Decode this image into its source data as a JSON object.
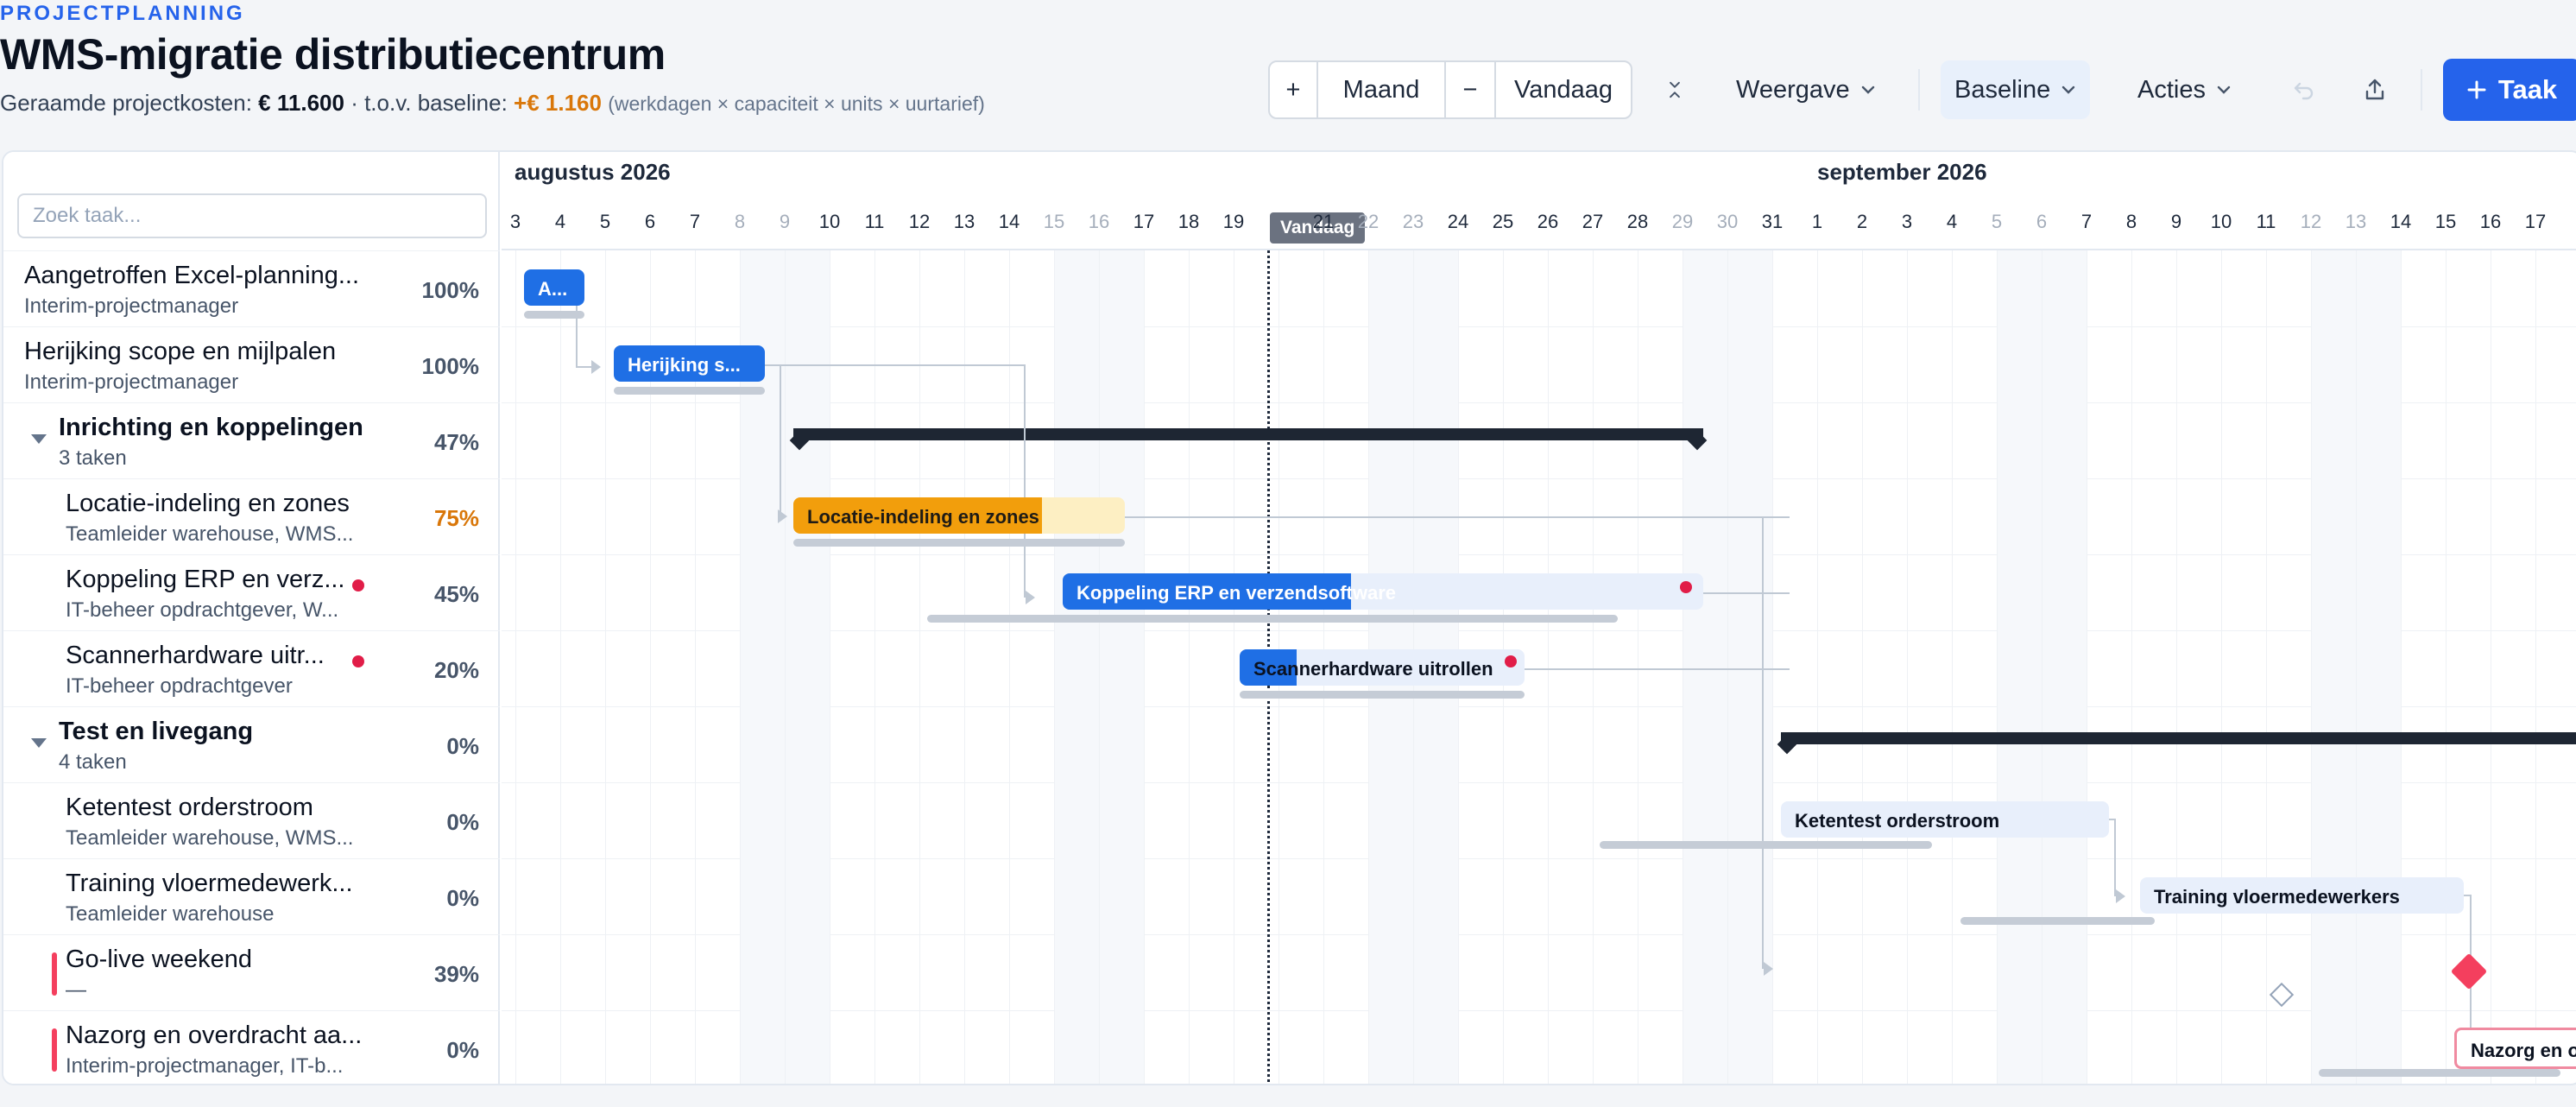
{
  "header": {
    "eyebrow": "PROJECTPLANNING",
    "title": "WMS-migratie distributiecentrum",
    "cost_label": "Geraamde projectkosten:",
    "cost_value": "€ 11.600",
    "baseline_label": "· t.o.v. baseline:",
    "baseline_delta": "+€ 1.160",
    "formula_note": "(werkdagen × capaciteit × units × uurtarief)"
  },
  "toolbar": {
    "zoom_in": "+",
    "scale": "Maand",
    "zoom_out": "−",
    "today": "Vandaag",
    "collapse_icon": "collapse-icon",
    "view": "Weergave",
    "baseline": "Baseline",
    "actions": "Acties",
    "undo_icon": "undo-icon",
    "export_icon": "export-icon",
    "add_task": "Taak",
    "accent": "#2563eb"
  },
  "search": {
    "placeholder": "Zoek taak..."
  },
  "timeline": {
    "months": [
      "augustus 2026",
      "september 2026"
    ],
    "days": [
      "3",
      "4",
      "5",
      "6",
      "7",
      "8",
      "9",
      "10",
      "11",
      "12",
      "13",
      "14",
      "15",
      "16",
      "17",
      "18",
      "19",
      "20",
      "21",
      "22",
      "23",
      "24",
      "25",
      "26",
      "27",
      "28",
      "29",
      "30",
      "31",
      "1",
      "2",
      "3",
      "4",
      "5",
      "6",
      "7",
      "8",
      "9",
      "10",
      "11",
      "12",
      "13",
      "14",
      "15",
      "16",
      "17"
    ],
    "today_label": "Vandaag"
  },
  "tasks": [
    {
      "name": "Aangetroffen Excel-planning...",
      "sub": "Interim-projectmanager",
      "pct": "100%",
      "bar_label": "A..."
    },
    {
      "name": "Herijking scope en mijlpalen",
      "sub": "Interim-projectmanager",
      "pct": "100%",
      "bar_label": "Herijking s..."
    },
    {
      "name": "Inrichting en koppelingen",
      "sub": "3 taken",
      "pct": "47%"
    },
    {
      "name": "Locatie-indeling en zones",
      "sub": "Teamleider warehouse, WMS...",
      "pct": "75%",
      "bar_label": "Locatie-indeling en zones"
    },
    {
      "name": "Koppeling ERP en verz...",
      "sub": "IT-beheer opdrachtgever, W...",
      "pct": "45%",
      "bar_label": "Koppeling ERP en verzendsoftware"
    },
    {
      "name": "Scannerhardware uitr...",
      "sub": "IT-beheer opdrachtgever",
      "pct": "20%",
      "bar_label": "Scannerhardware uitrollen"
    },
    {
      "name": "Test en livegang",
      "sub": "4 taken",
      "pct": "0%"
    },
    {
      "name": "Ketentest orderstroom",
      "sub": "Teamleider warehouse, WMS...",
      "pct": "0%",
      "bar_label": "Ketentest orderstroom"
    },
    {
      "name": "Training vloermedewerk...",
      "sub": "Teamleider warehouse",
      "pct": "0%",
      "bar_label": "Training vloermedewerkers"
    },
    {
      "name": "Go-live weekend",
      "sub": "—",
      "pct": "39%"
    },
    {
      "name": "Nazorg en overdracht aa...",
      "sub": "Interim-projectmanager, IT-b...",
      "pct": "0%",
      "bar_label": "Nazorg en o"
    }
  ]
}
